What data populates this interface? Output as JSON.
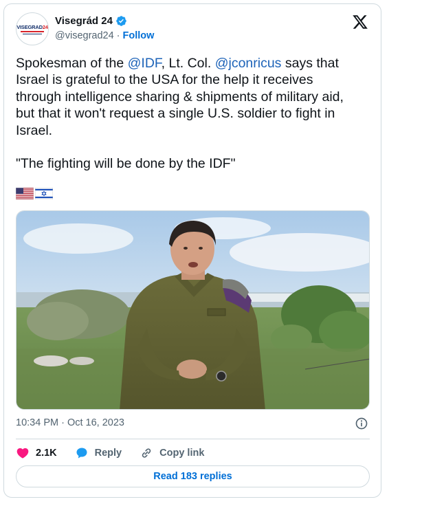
{
  "author": {
    "display_name": "Visegrád 24",
    "avatar_text_left": "VISEGRAD",
    "avatar_text_right": "24",
    "handle": "@visegrad24",
    "separator": "·",
    "follow_label": "Follow",
    "verified": true
  },
  "tweet": {
    "p1_a": "Spokesman of the ",
    "p1_mention1": "@IDF",
    "p1_b": ", Lt. Col. ",
    "p1_mention2": "@jconricus",
    "p1_c": " says that\nIsrael is grateful to the USA for the help it receives\nthrough intelligence sharing & shipments of military aid,\nbut that it won't request a single U.S. soldier to fight in\nIsrael.",
    "p2": "\"The fighting will be done by the IDF\"",
    "flags": [
      "US flag",
      "Israel flag"
    ]
  },
  "meta": {
    "timestamp": "10:34 PM · Oct 16, 2023"
  },
  "actions": {
    "likes": "2.1K",
    "reply_label": "Reply",
    "copy_link_label": "Copy link"
  },
  "read_replies_label": "Read 183 replies",
  "colors": {
    "link": "#006fd6",
    "mention": "#1d63b8",
    "heart": "#f91880",
    "muted": "#536471",
    "border": "#cfd9de",
    "verified": "#1d9bf0"
  },
  "icons": [
    "verified-badge-icon",
    "x-logo-icon",
    "info-icon",
    "heart-icon",
    "reply-bubble-icon",
    "link-icon"
  ]
}
